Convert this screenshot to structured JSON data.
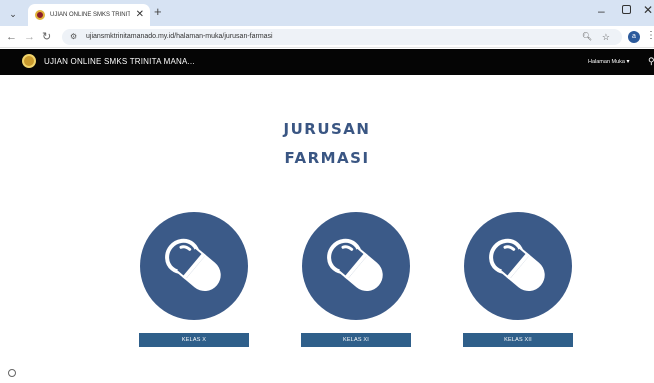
{
  "browser": {
    "tab_title": "UJIAN ONLINE SMKS TRINITA",
    "tab_close": "✕",
    "new_tab": "+",
    "url": "ujiansmktrinitamanado.my.id/halaman-muka/jurusan-farmasi",
    "window_min": "–",
    "window_close": "✕",
    "profile_initial": "a"
  },
  "site": {
    "name": "UJIAN ONLINE SMKS TRINITA MANA...",
    "menu_label": "Halaman Muka",
    "menu_chevron": "▾"
  },
  "page": {
    "heading_line1": "JURUSAN",
    "heading_line2": "FARMASI"
  },
  "cards": [
    {
      "icon": "pill-icon",
      "button_label": "KELAS X"
    },
    {
      "icon": "pill-icon",
      "button_label": "KELAS XI"
    },
    {
      "icon": "pill-icon",
      "button_label": "KELAS XII"
    }
  ],
  "colors": {
    "accent_blue": "#3b5a88",
    "button_blue": "#2f5f8a",
    "heading_blue": "#3a5683",
    "navbar_black": "#050505"
  }
}
